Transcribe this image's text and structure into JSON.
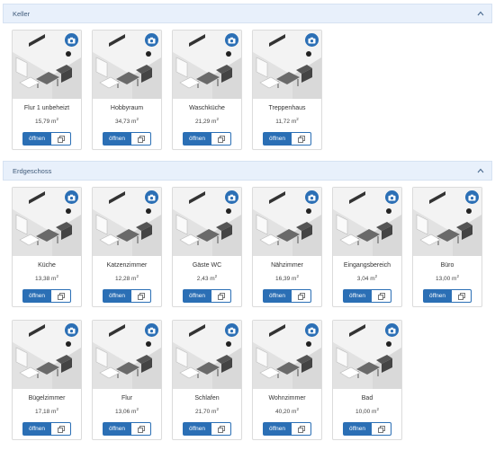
{
  "sections": [
    {
      "title": "Keller",
      "rooms": [
        {
          "name": "Flur 1 unbeheizt",
          "area": "15,79 m",
          "unit_sup": "2",
          "open_label": "öffnen"
        },
        {
          "name": "Hobbyraum",
          "area": "34,73 m",
          "unit_sup": "2",
          "open_label": "öffnen"
        },
        {
          "name": "Waschküche",
          "area": "21,29 m",
          "unit_sup": "2",
          "open_label": "öffnen"
        },
        {
          "name": "Treppenhaus",
          "area": "11,72 m",
          "unit_sup": "2",
          "open_label": "öffnen"
        }
      ]
    },
    {
      "title": "Erdgeschoss",
      "rooms": [
        {
          "name": "Küche",
          "area": "13,38 m",
          "unit_sup": "2",
          "open_label": "öffnen"
        },
        {
          "name": "Katzenzimmer",
          "area": "12,28 m",
          "unit_sup": "2",
          "open_label": "öffnen"
        },
        {
          "name": "Gäste WC",
          "area": "2,43 m",
          "unit_sup": "2",
          "open_label": "öffnen"
        },
        {
          "name": "Nähzimmer",
          "area": "16,39 m",
          "unit_sup": "2",
          "open_label": "öffnen"
        },
        {
          "name": "Eingangsbereich",
          "area": "3,04 m",
          "unit_sup": "2",
          "open_label": "öffnen"
        },
        {
          "name": "Büro",
          "area": "13,00 m",
          "unit_sup": "2",
          "open_label": "öffnen"
        },
        {
          "name": "Bügelzimmer",
          "area": "17,18 m",
          "unit_sup": "2",
          "open_label": "öffnen"
        },
        {
          "name": "Flur",
          "area": "13,06 m",
          "unit_sup": "2",
          "open_label": "öffnen"
        },
        {
          "name": "Schlafen",
          "area": "21,70 m",
          "unit_sup": "2",
          "open_label": "öffnen"
        },
        {
          "name": "Wohnzimmer",
          "area": "40,20 m",
          "unit_sup": "2",
          "open_label": "öffnen"
        },
        {
          "name": "Bad",
          "area": "10,00 m",
          "unit_sup": "2",
          "open_label": "öffnen"
        }
      ]
    }
  ],
  "icons": {
    "collapse": "chevron-up-icon",
    "camera": "camera-icon",
    "copy": "copy-icon"
  },
  "colors": {
    "accent": "#2b6fb5",
    "header_bg": "#e8f0fb"
  }
}
